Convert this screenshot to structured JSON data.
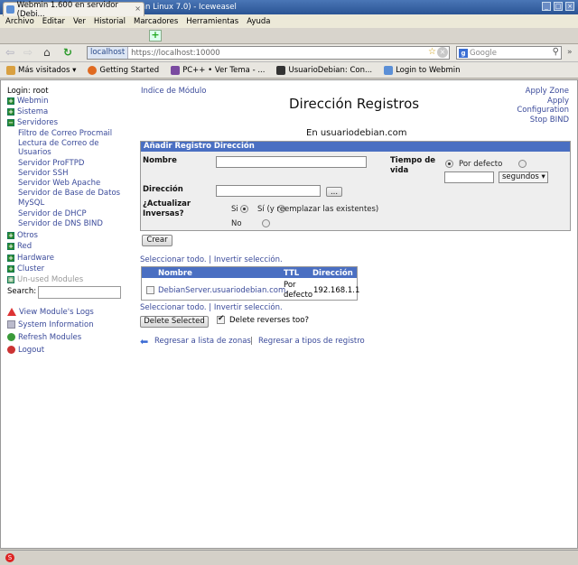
{
  "window": {
    "title": "Webmin 1.600 en servidor (Debian Linux 7.0) - Iceweasel"
  },
  "menubar": [
    "Archivo",
    "Editar",
    "Ver",
    "Historial",
    "Marcadores",
    "Herramientas",
    "Ayuda"
  ],
  "tab": {
    "title": "Webmin 1.600 en servidor (Debi...",
    "close": "×",
    "new": "+"
  },
  "nav": {
    "host": "localhost",
    "url": "https://localhost:10000",
    "search_placeholder": "Google"
  },
  "bookmarks": [
    "Más visitados ▾",
    "Getting Started",
    "PC++ • Ver Tema - ...",
    "UsuarioDebian: Con...",
    "Login to Webmin"
  ],
  "sidebar": {
    "login": "Login: root",
    "cats_top": [
      "Webmin",
      "Sistema",
      "Servidores"
    ],
    "modules": [
      "Filtro de Correo Procmail",
      "Lectura de Correo de",
      "Usuarios",
      "Servidor ProFTPD",
      "Servidor SSH",
      "Servidor Web Apache",
      "Servidor de Base de Datos",
      "MySQL",
      "Servidor de DHCP",
      "Servidor de DNS BIND"
    ],
    "cats_bottom": [
      "Otros",
      "Red",
      "Hardware",
      "Cluster",
      "Un-used Modules"
    ],
    "search_label": "Search:",
    "links": [
      "View Module's Logs",
      "System Information",
      "Refresh Modules",
      "Logout"
    ]
  },
  "main": {
    "index_link": "Indice de Módulo",
    "title": "Dirección Registros",
    "right_links": [
      "Apply Zone",
      "Apply",
      "Configuration",
      "Stop BIND"
    ],
    "subtitle": "En usuariodebian.com",
    "form": {
      "header": "Añadir Registro Dirección",
      "name_label": "Nombre",
      "ttl_label": "Tiempo de vida",
      "ttl_default": "Por defecto",
      "ttl_unit": "segundos ▾",
      "address_label": "Dirección",
      "address_btn": "...",
      "reverse_label": "¿Actualizar Inversas?",
      "reverse_opts": [
        "Si",
        "Sí (y reemplazar las existentes)",
        "No"
      ],
      "create_btn": "Crear"
    },
    "select_links": "Seleccionar todo. | Invertir selección.",
    "table": {
      "headers": [
        "Nombre",
        "TTL",
        "Dirección"
      ],
      "row": {
        "name": "DebianServer.usuariodebian.com.",
        "ttl": "Por defecto",
        "address": "192.168.1.1"
      }
    },
    "delete_btn": "Delete Selected",
    "delete_reverses": "Delete reverses too?",
    "back_links": [
      "Regresar a lista de zonas",
      "Regresar a tipos de registro"
    ]
  },
  "colors": {
    "accent": "#4a6fc2",
    "link": "#3a4a9a",
    "category_icon": "#2e8a2e"
  }
}
